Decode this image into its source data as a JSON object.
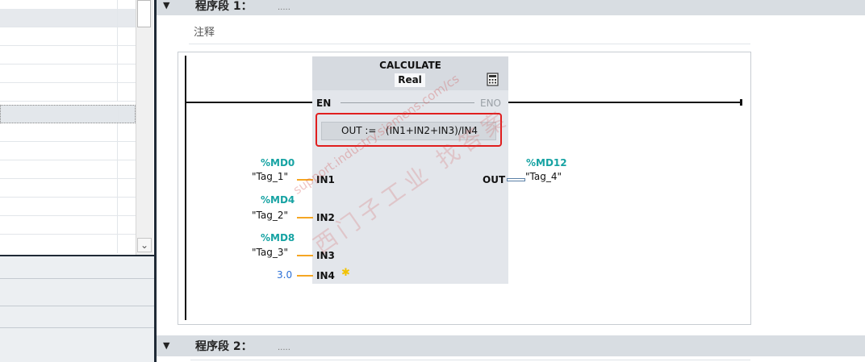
{
  "network1": {
    "title": "程序段 1：",
    "dots": ".....",
    "comment": "注释"
  },
  "network2": {
    "title": "程序段 2：",
    "dots": "....."
  },
  "block": {
    "name": "CALCULATE",
    "type": "Real",
    "en": "EN",
    "eno": "ENO",
    "formula": "OUT :=   (IN1+IN2+IN3)/IN4",
    "inputs": [
      {
        "pin": "IN1",
        "address": "%MD0",
        "tag": "\"Tag_1\""
      },
      {
        "pin": "IN2",
        "address": "%MD4",
        "tag": "\"Tag_2\""
      },
      {
        "pin": "IN3",
        "address": "%MD8",
        "tag": "\"Tag_3\""
      },
      {
        "pin": "IN4",
        "constant": "3.0"
      }
    ],
    "output": {
      "pin": "OUT",
      "address": "%MD12",
      "tag": "\"Tag_4\""
    }
  },
  "icons": {
    "expand": "triangle-down-icon",
    "calculator": "calculator-icon",
    "add_input": "star-icon",
    "scroll_down": "chevron-down-icon"
  },
  "watermark": {
    "url": "support.industry.siemens.com/cs",
    "cn": "西门子工业  找答案"
  },
  "colors": {
    "address": "#17a3a3",
    "constant": "#2b6fd6",
    "wire": "#f5a623",
    "highlight": "#e01e1e"
  }
}
